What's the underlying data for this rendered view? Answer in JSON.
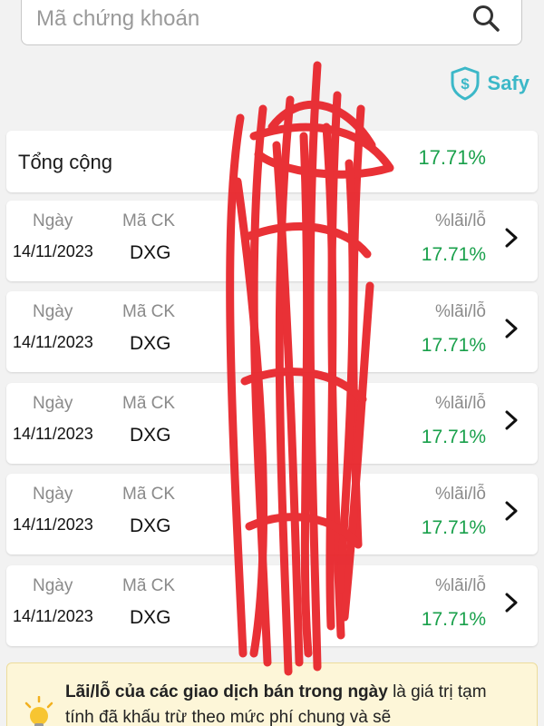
{
  "search": {
    "placeholder": "Mã chứng khoán"
  },
  "brand": {
    "label": "Safy",
    "color": "#3cb8c8"
  },
  "total": {
    "label": "Tổng cộng",
    "value": "17.71%"
  },
  "columns": {
    "date": "Ngày",
    "code": "Mã CK",
    "pct": "%lãi/lỗ"
  },
  "rows": [
    {
      "date": "14/11/2023",
      "code": "DXG",
      "pct": "17.71%"
    },
    {
      "date": "14/11/2023",
      "code": "DXG",
      "pct": "17.71%"
    },
    {
      "date": "14/11/2023",
      "code": "DXG",
      "pct": "17.71%"
    },
    {
      "date": "14/11/2023",
      "code": "DXG",
      "pct": "17.71%"
    },
    {
      "date": "14/11/2023",
      "code": "DXG",
      "pct": "17.71%"
    }
  ],
  "notice": {
    "bold": "Lãi/lỗ của các giao dịch bán trong ngày",
    "rest": " là giá trị tạm tính đã khấu trừ theo mức phí chung và sẽ"
  },
  "colors": {
    "gain": "#19a04b",
    "scribble": "#e8262c",
    "notice_bg": "#fdf6d8"
  }
}
